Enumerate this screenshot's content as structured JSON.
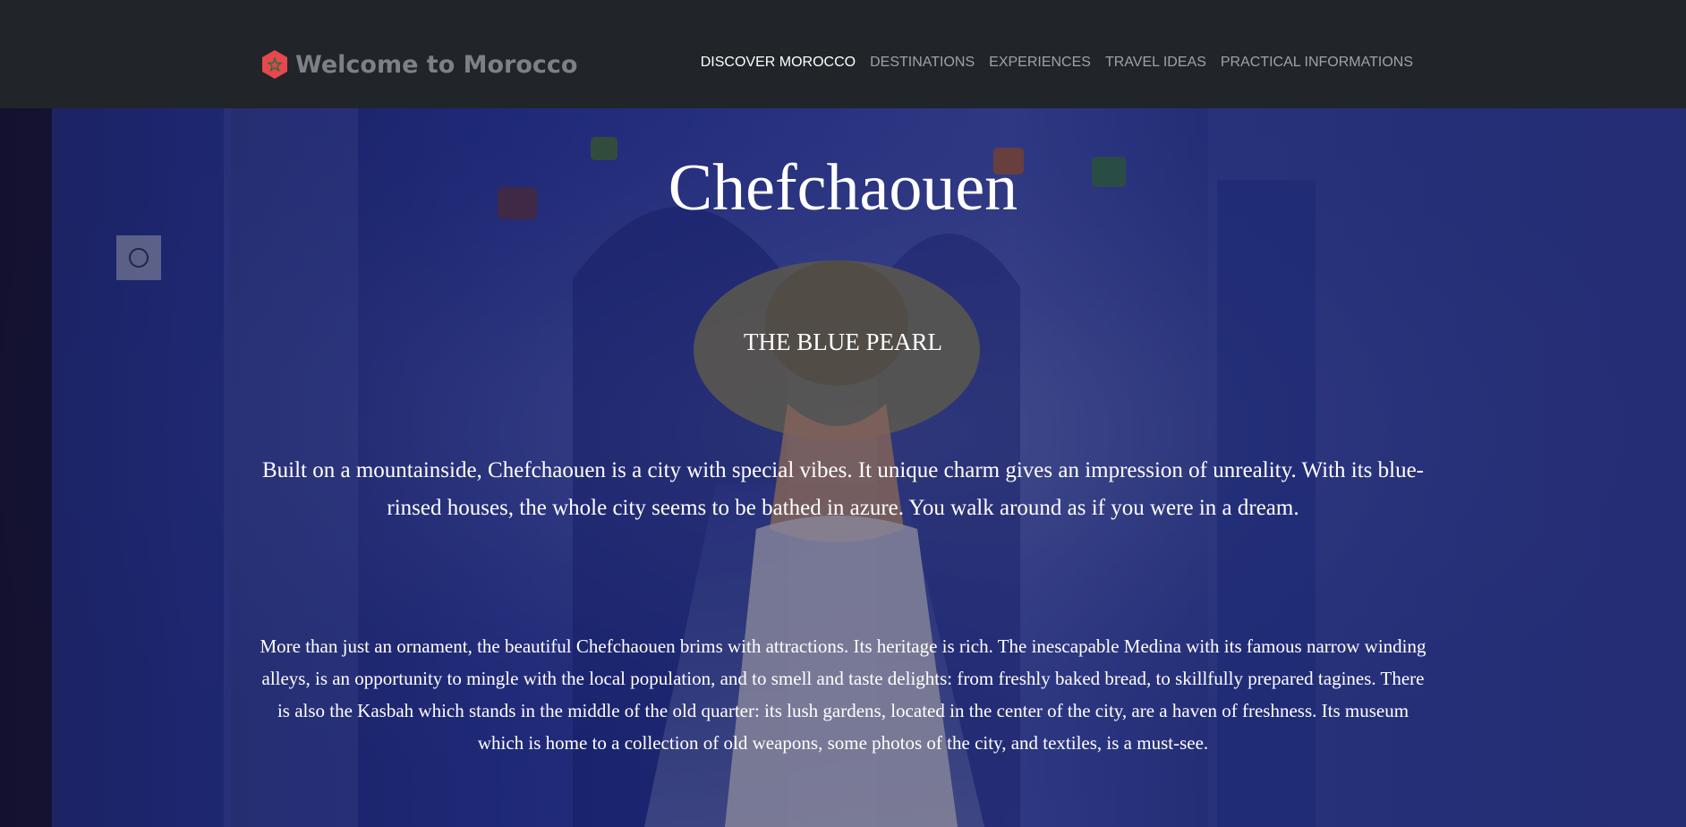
{
  "navbar": {
    "brand_text": "Welcome to Morocco",
    "brand_icon": "moroccan-star-hexagon-icon",
    "links": [
      {
        "label": "DISCOVER MOROCCO",
        "active": true
      },
      {
        "label": "DESTINATIONS",
        "active": false
      },
      {
        "label": "EXPERIENCES",
        "active": false
      },
      {
        "label": "TRAVEL IDEAS",
        "active": false
      },
      {
        "label": "PRACTICAL INFORMATIONS",
        "active": false
      }
    ]
  },
  "hero": {
    "title": "Chefchaouen",
    "subtitle": "THE BLUE PEARL",
    "lead": "Built on a mountainside, Chefchaouen is a city with special vibes. It unique charm gives an impression of unreality. With its blue-rinsed houses, the whole city seems to be bathed in azure. You walk around as if you were in a dream.",
    "body": "More than just an ornament, the beautiful Chefchaouen brims with attractions. Its heritage is rich. The inescapable Medina with its famous narrow winding alleys, is an opportunity to mingle with the local population, and to smell and taste delights: from freshly baked bread, to skillfully prepared tagines. There is also the Kasbah which stands in the middle of the old quarter: its lush gardens, located in the center of the city, are a haven of freshness. Its museum which is home to a collection of old weapons, some photos of the city, and textiles, is a must-see."
  },
  "colors": {
    "navbar_bg": "#212529",
    "brand_text": "#7c8187",
    "brand_icon": "#e5484d",
    "nav_link": "#9ea3a8",
    "nav_link_active": "#ffffff",
    "hero_blue": "#2b3aa8"
  }
}
